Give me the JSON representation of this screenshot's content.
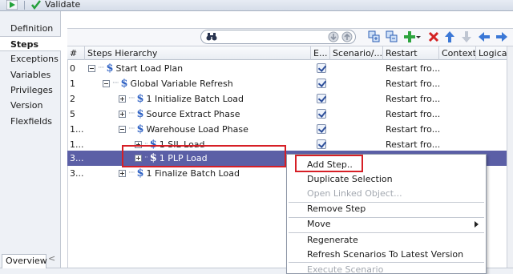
{
  "toolbar": {
    "validate_label": "Validate"
  },
  "nav": {
    "items": [
      {
        "label": "Definition"
      },
      {
        "label": "Steps"
      },
      {
        "label": "Exceptions"
      },
      {
        "label": "Variables"
      },
      {
        "label": "Privileges"
      },
      {
        "label": "Version"
      },
      {
        "label": "Flexfields"
      }
    ],
    "active": "Steps",
    "overview_label": "Overview"
  },
  "table": {
    "headers": [
      "#",
      "Steps Hierarchy",
      "E...",
      "Scenario/...",
      "Restart",
      "Context",
      "Logica..."
    ],
    "rows": [
      {
        "num": "0",
        "name": "Start Load Plan",
        "enabled": true,
        "restart": "Restart fro...",
        "depth": 0,
        "expander": "minus"
      },
      {
        "num": "1",
        "name": "Global Variable Refresh",
        "enabled": true,
        "restart": "Restart fro...",
        "depth": 1,
        "expander": "minus"
      },
      {
        "num": "2",
        "name": "1 Initialize Batch Load",
        "enabled": true,
        "restart": "Restart fro...",
        "depth": 2,
        "expander": "plus"
      },
      {
        "num": "5",
        "name": "Source Extract Phase",
        "enabled": true,
        "restart": "Restart fro...",
        "depth": 2,
        "expander": "plus"
      },
      {
        "num": "1...",
        "name": "Warehouse Load Phase",
        "enabled": true,
        "restart": "Restart fro...",
        "depth": 2,
        "expander": "minus"
      },
      {
        "num": "1...",
        "name": "1 SIL Load",
        "enabled": true,
        "restart": "Restart fro...",
        "depth": 3,
        "expander": "plus"
      },
      {
        "num": "3...",
        "name": "1 PLP Load",
        "enabled": true,
        "restart": "Restart fro...",
        "depth": 3,
        "expander": "plus",
        "selected": true
      },
      {
        "num": "3...",
        "name": "1 Finalize Batch Load",
        "enabled": true,
        "restart": "Restart fro...",
        "depth": 2,
        "expander": "plus"
      }
    ]
  },
  "context_menu": {
    "items": [
      {
        "label": "Add Step..",
        "disabled": false
      },
      {
        "label": "Duplicate Selection",
        "disabled": false
      },
      {
        "label": "Open Linked Object...",
        "disabled": true
      },
      {
        "label": "Remove Step",
        "disabled": false
      },
      {
        "label": "Move",
        "disabled": false,
        "submenu": true
      },
      {
        "label": "Regenerate",
        "disabled": false
      },
      {
        "label": "Refresh Scenarios To Latest Version",
        "disabled": false
      },
      {
        "label": "Execute Scenario",
        "disabled": true
      }
    ]
  },
  "colors": {
    "selection": "#5b5fa6",
    "highlight_red": "#d61f26",
    "step_icon": "#2f62c4"
  }
}
